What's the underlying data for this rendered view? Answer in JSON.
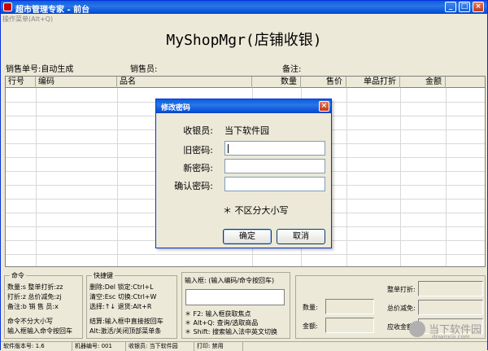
{
  "window": {
    "title": "超市管理专家 - 前台",
    "menu_hint": "操作菜单(Alt+Q)"
  },
  "header": {
    "title": "MyShopMgr(店铺收银)"
  },
  "info": {
    "order_no": "销售单号:自动生成",
    "salesperson": "销售员:",
    "note": "备注:"
  },
  "table": {
    "columns": [
      "行号",
      "编码",
      "品名",
      "数量",
      "售价",
      "单品打折",
      "金额"
    ]
  },
  "dialog": {
    "title": "修改密码",
    "cashier_label": "收银员:",
    "cashier_value": "当下软件园",
    "old_label": "旧密码:",
    "new_label": "新密码:",
    "confirm_label": "确认密码:",
    "old_value": "",
    "new_value": "",
    "confirm_value": "",
    "note": "＊ 不区分大小写",
    "ok": "确定",
    "cancel": "取消"
  },
  "commands": {
    "label": "命令",
    "lines": [
      "数量:s    整单打折:zz",
      "打折:z    总价减免:zj",
      "备注:b    销 售 员:x"
    ],
    "foot": [
      "命令不分大小写",
      "输入框输入命令按回车"
    ]
  },
  "shortcuts": {
    "label": "快捷键",
    "lines": [
      "删除:Del    锁定:Ctrl+L",
      "清空:Esc    切换:Ctrl+W",
      "选择:↑↓    退货:Alt+R"
    ],
    "foot": [
      "结算:输入框中直接按回车",
      "Alt:激活/关闭顶部菜单条"
    ]
  },
  "input_panel": {
    "label": "输入框: (输入编码/命令按回车)",
    "value": "",
    "hints": [
      "＊ F2: 输入框获取焦点",
      "＊ Alt+Q: 查询/选取商品",
      "＊ Shift: 搜索输入法中英文切换"
    ]
  },
  "totals": {
    "qty": "数量:",
    "amount": "金额:",
    "whole_discount": "整单打折:",
    "total_reduce": "总价减免:",
    "receivable": "应收金额:"
  },
  "status": {
    "version": "软件版本号: 1.6",
    "machine": "机器编号: 001",
    "cashier": "收银员: 当下软件园",
    "print": "打印: 禁用"
  },
  "watermark": {
    "text": "当下软件园",
    "sub": "downxia.com"
  }
}
